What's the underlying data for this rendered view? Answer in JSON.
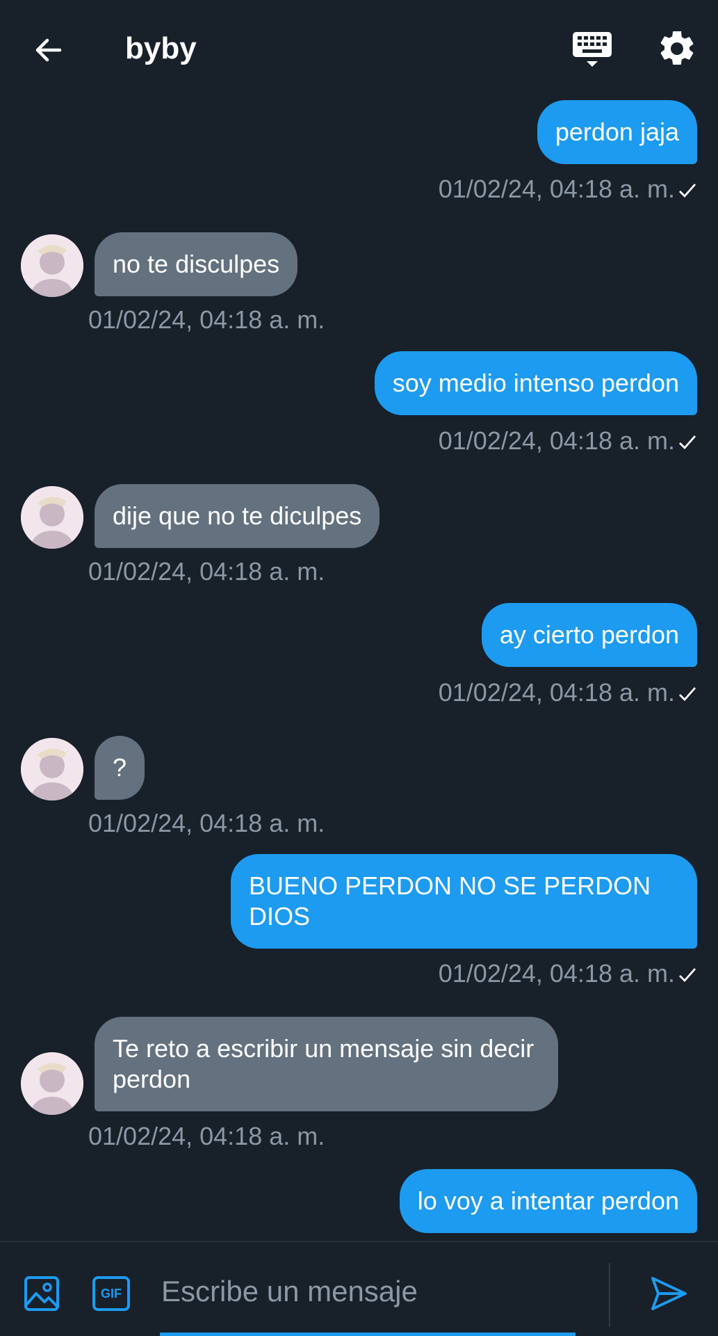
{
  "header": {
    "title": "byby",
    "icons": {
      "back": "back-arrow-icon",
      "keyboard": "keyboard-icon",
      "settings": "gear-icon"
    }
  },
  "messages": [
    {
      "side": "out",
      "text": "perdon jaja",
      "time": "01/02/24, 04:18 a. m."
    },
    {
      "side": "in",
      "text": "no te disculpes",
      "time": "01/02/24, 04:18 a. m."
    },
    {
      "side": "out",
      "text": "soy medio intenso perdon",
      "time": "01/02/24, 04:18 a. m."
    },
    {
      "side": "in",
      "text": "dije que no te diculpes",
      "time": "01/02/24, 04:18 a. m."
    },
    {
      "side": "out",
      "text": "ay cierto perdon",
      "time": "01/02/24, 04:18 a. m."
    },
    {
      "side": "in",
      "text": "?",
      "time": "01/02/24, 04:18 a. m."
    },
    {
      "side": "out",
      "text": "BUENO PERDON NO SE PERDON DIOS",
      "time": "01/02/24, 04:18 a. m."
    },
    {
      "side": "in",
      "text": "Te reto a escribir un mensaje sin decir perdon",
      "time": "01/02/24, 04:18 a. m."
    },
    {
      "side": "out",
      "text": "lo voy a intentar perdon"
    }
  ],
  "composer": {
    "placeholder": "Escribe un mensaje",
    "gif_label": "GIF",
    "icons": {
      "image": "image-icon",
      "gif": "gif-icon",
      "send": "send-icon"
    }
  },
  "colors": {
    "background": "#18202a",
    "outgoing_bubble": "#1d9bf0",
    "incoming_bubble": "#64717f",
    "timestamp": "#8b98a5",
    "accent": "#1d9bf0"
  }
}
